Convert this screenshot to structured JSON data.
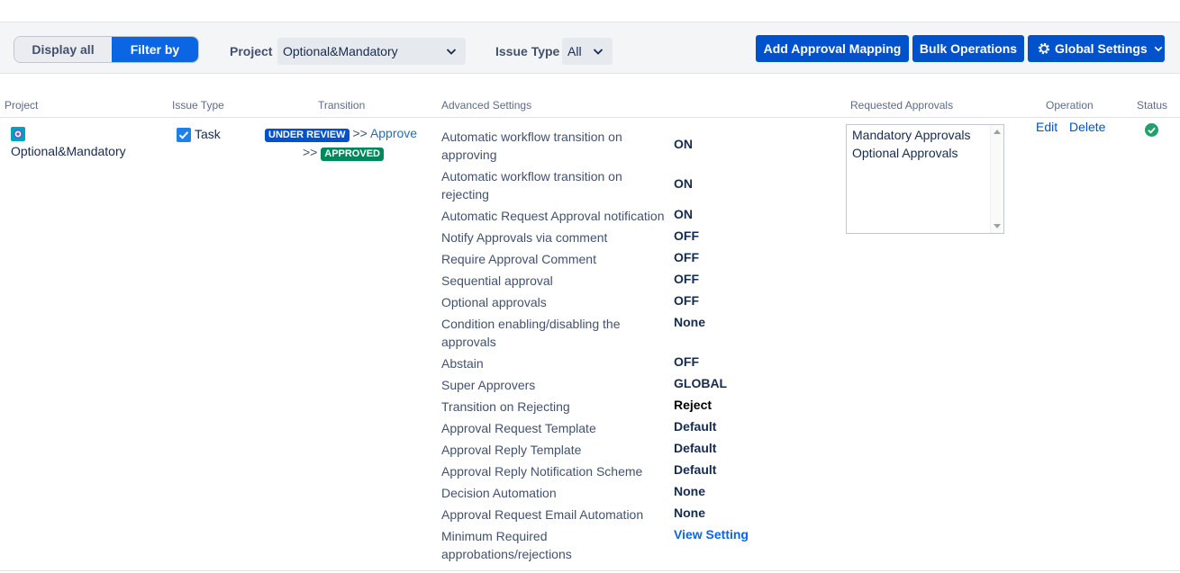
{
  "toolbar": {
    "display_all": "Display all",
    "filter_by": "Filter by",
    "project_label": "Project",
    "project_value": "Optional&Mandatory",
    "issue_type_label": "Issue Type",
    "issue_type_value": "All",
    "add_mapping": "Add Approval Mapping",
    "bulk_ops": "Bulk Operations",
    "global_settings": "Global Settings"
  },
  "table": {
    "headers": {
      "project": "Project",
      "issue_type": "Issue Type",
      "transition": "Transition",
      "advanced": "Advanced Settings",
      "requested": "Requested Approvals",
      "operation": "Operation",
      "status": "Status"
    },
    "row": {
      "project": "Optional&Mandatory",
      "issue_type": "Task",
      "from_status": "UNDER REVIEW",
      "arrow1": ">>",
      "transition": "Approve",
      "arrow2": ">>",
      "to_status": "APPROVED",
      "edit": "Edit",
      "delete": "Delete",
      "requested": [
        "Mandatory Approvals",
        "Optional Approvals"
      ],
      "settings": [
        {
          "label": "Automatic workflow transition on approving",
          "value": "ON"
        },
        {
          "label": "Automatic workflow transition on rejecting",
          "value": "ON"
        },
        {
          "label": "Automatic Request Approval notification",
          "value": "ON"
        },
        {
          "label": "Notify Approvals via comment",
          "value": "OFF"
        },
        {
          "label": "Require Approval Comment",
          "value": "OFF"
        },
        {
          "label": "Sequential approval",
          "value": "OFF"
        },
        {
          "label": "Optional approvals",
          "value": "OFF"
        },
        {
          "label": "Condition enabling/disabling the approvals",
          "value": "None"
        },
        {
          "label": "Abstain",
          "value": "OFF"
        },
        {
          "label": "Super Approvers",
          "value": "GLOBAL"
        },
        {
          "label": "Transition on Rejecting",
          "value": "Reject"
        },
        {
          "label": "Approval Request Template",
          "value": "Default"
        },
        {
          "label": "Approval Reply Template",
          "value": "Default"
        },
        {
          "label": "Approval Reply Notification Scheme",
          "value": "Default"
        },
        {
          "label": "Decision Automation",
          "value": "None"
        },
        {
          "label": "Approval Request Email Automation",
          "value": "None"
        },
        {
          "label": "Minimum Required approbations/rejections",
          "value": "View Setting"
        }
      ]
    }
  },
  "icons": {
    "project_avatar": "project-avatar-icon",
    "checkbox": "checkbox-checked-icon",
    "status": "check-circle-icon",
    "gear": "gear-icon",
    "chevron": "chevron-down-icon"
  },
  "colors": {
    "primary": "#0052cc",
    "filter_active": "#0b66e4",
    "under_review": "#0052cc",
    "approved": "#00875a",
    "status_ok": "#22a06b"
  }
}
